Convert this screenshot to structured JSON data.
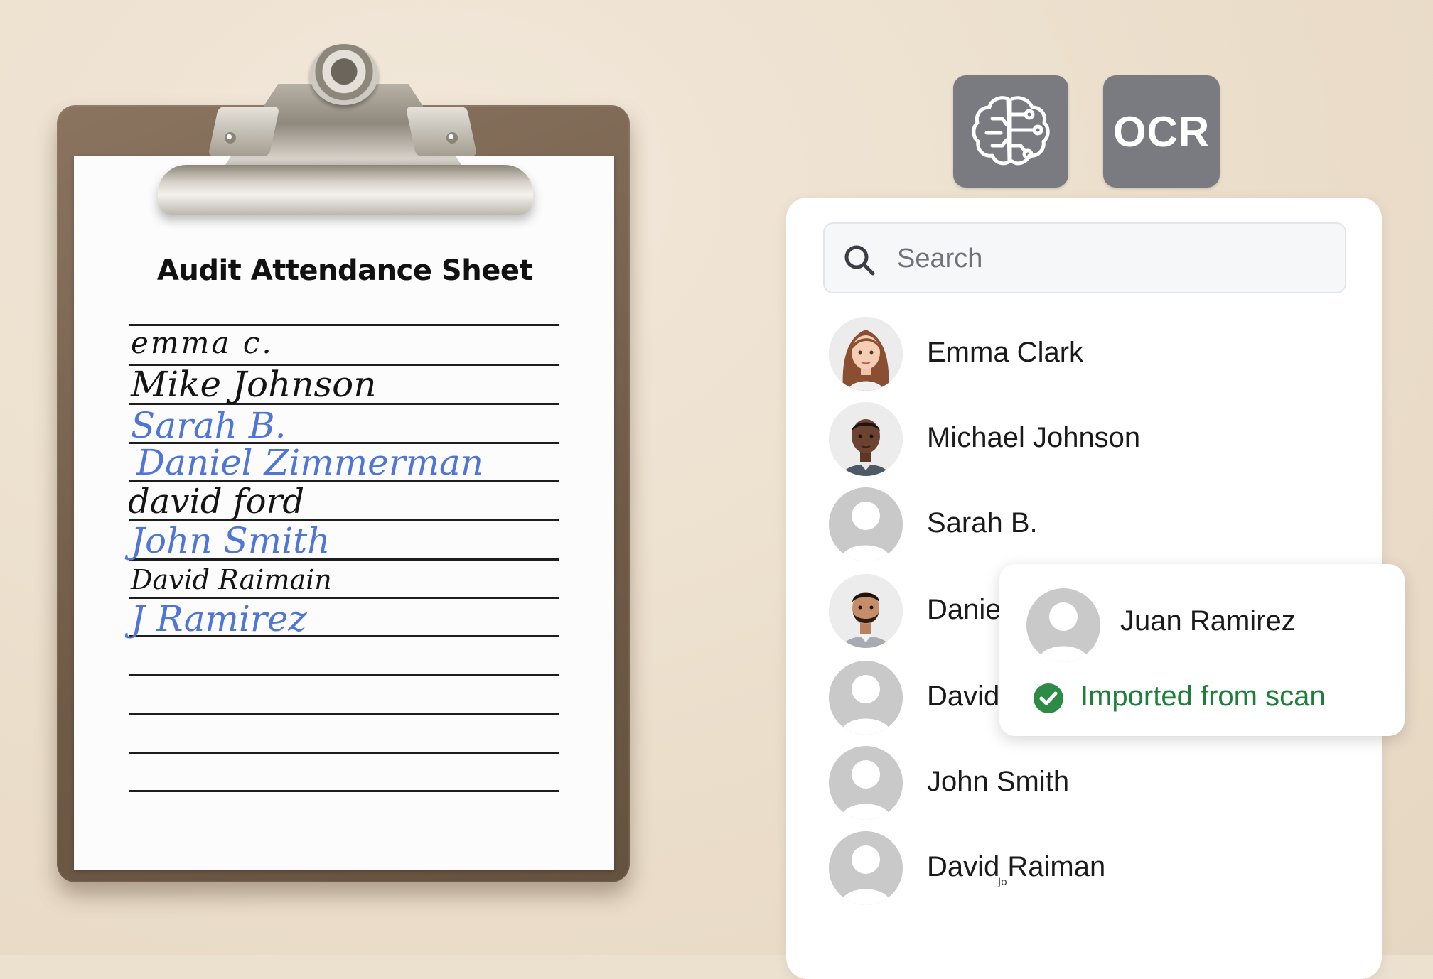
{
  "toolbar": {
    "ai_icon": "brain-circuit-icon",
    "ocr_label": "OCR"
  },
  "sheet": {
    "title": "Audit Attendance Sheet",
    "signatures": [
      {
        "text": "emma c.",
        "ink": "black"
      },
      {
        "text": "Mike Johnson",
        "ink": "black"
      },
      {
        "text": "Sarah B.",
        "ink": "blue"
      },
      {
        "text": "Daniel Zimmerman",
        "ink": "blue"
      },
      {
        "text": "david ford",
        "ink": "black"
      },
      {
        "text": "John Smith",
        "ink": "blue"
      },
      {
        "text": "David Raimain",
        "ink": "black"
      },
      {
        "text": "J Ramirez",
        "ink": "blue"
      }
    ]
  },
  "search": {
    "placeholder": "Search",
    "icon": "search-icon"
  },
  "contacts": [
    {
      "name": "Emma Clark",
      "avatar": "photo-woman"
    },
    {
      "name": "Michael Johnson",
      "avatar": "photo-man"
    },
    {
      "name": "Sarah B.",
      "avatar": "placeholder"
    },
    {
      "name": "Daniel Zimmerman",
      "avatar": "photo-bearded-man"
    },
    {
      "name": "David Ford",
      "avatar": "placeholder"
    },
    {
      "name": "John Smith",
      "avatar": "placeholder"
    },
    {
      "name": "David Raiman",
      "avatar": "placeholder"
    }
  ],
  "popover": {
    "name": "Juan Ramirez",
    "status": "Imported from scan",
    "status_color": "#1e7f3a"
  },
  "cursor_tooltip": "Jo"
}
